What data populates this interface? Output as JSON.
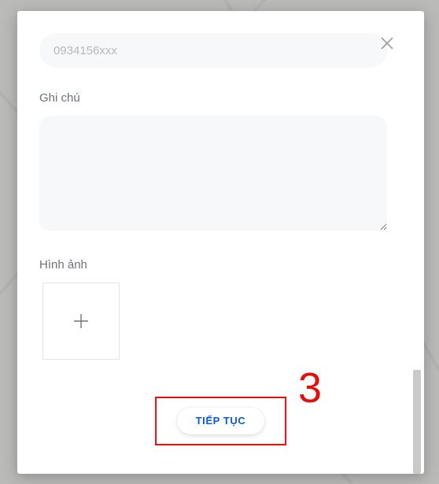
{
  "form": {
    "phone_placeholder": "0934156xxx",
    "note_label": "Ghi chú",
    "note_value": "",
    "image_label": "Hình ảnh"
  },
  "cta": {
    "continue_label": "TIẾP TỤC"
  },
  "annotation": {
    "step": "3"
  }
}
